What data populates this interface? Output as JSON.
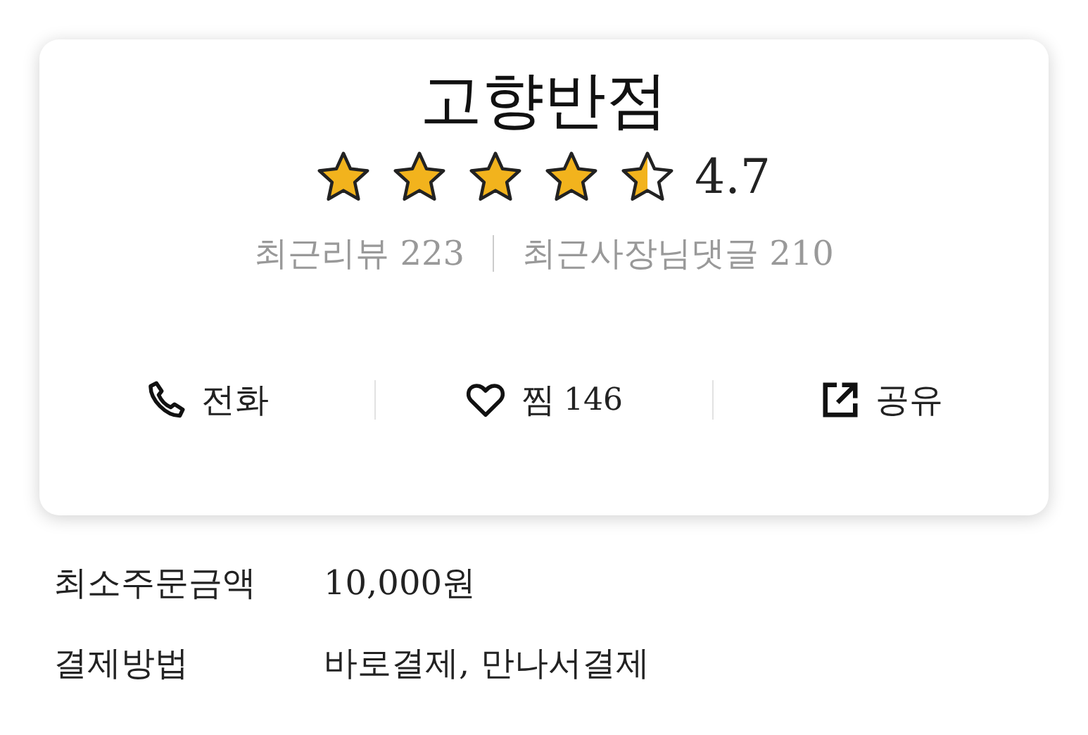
{
  "store": {
    "name": "고향반점",
    "stars": 4.5,
    "rating": "4.7",
    "reviews": "최근리뷰 223",
    "replies": "최근사장님댓글 210"
  },
  "actions": [
    {
      "kind": "call",
      "label": "전화"
    },
    {
      "kind": "like",
      "label": "찜",
      "count": "146"
    },
    {
      "kind": "share",
      "label": "공유"
    }
  ],
  "info": [
    {
      "label": "최소주문금액",
      "value": "10,000원"
    },
    {
      "label": "결제방법",
      "value": "바로결제, 만나서결제"
    }
  ]
}
